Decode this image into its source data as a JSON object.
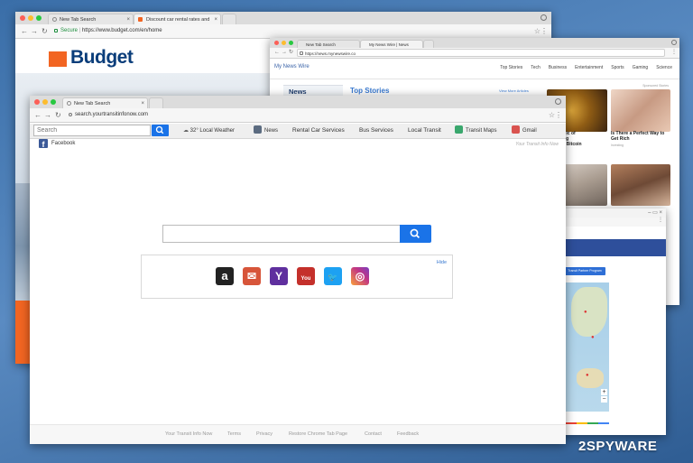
{
  "window_budget": {
    "tabs": [
      {
        "label": "New Tab Search"
      },
      {
        "label": "Discount car rental rates and"
      }
    ],
    "secure_label": "Secure",
    "url": "https://www.budget.com/en/home",
    "logo_text": "Budget"
  },
  "window_news": {
    "tabs": [
      {
        "label": "New Tab Search"
      },
      {
        "label": "My News Wire | News"
      }
    ],
    "url": "https://news.mynewswire.co",
    "site_name": "My News Wire",
    "nav": [
      "Top Stories",
      "Tech",
      "Business",
      "Entertainment",
      "Sports",
      "Gaming",
      "Science"
    ],
    "section_label": "News",
    "top_stories": "Top Stories",
    "view_more": "View More Articles",
    "sponsored": "Sponsored Stories",
    "story1": "n Republic of\nAre Going\nhse This Bitcoin",
    "story2": "Is There a Perfect Way to\nGet Rich",
    "story2_src": "Investing"
  },
  "window_map": {
    "program_button": "Transit Partner Program"
  },
  "window_main": {
    "tab": {
      "label": "New Tab Search"
    },
    "url": "search.yourtransitinfonow.com",
    "toolbar": {
      "search_placeholder": "Search",
      "weather": "32° Local Weather",
      "items": [
        "News",
        "Rental Car Services",
        "Bus Services",
        "Local Transit",
        "Transit Maps",
        "Gmail"
      ]
    },
    "facebook_label": "Facebook",
    "brand_caption": "Your Transit Info Now",
    "hide_label": "Hide",
    "quicklinks": [
      {
        "icon": "amazon-icon",
        "glyph": "a",
        "color": "#222222"
      },
      {
        "icon": "mail-icon",
        "glyph": "✉",
        "color": "#d7553a"
      },
      {
        "icon": "yahoo-icon",
        "glyph": "Y",
        "color": "#5f2f9e"
      },
      {
        "icon": "youtube-icon",
        "glyph": "You",
        "color": "#c4302b"
      },
      {
        "icon": "twitter-icon",
        "glyph": "🐦",
        "color": "#1da1f2"
      },
      {
        "icon": "instagram-icon",
        "glyph": "◎",
        "color": "#c13584"
      }
    ],
    "footer": [
      "Your Transit Info Now",
      "Terms",
      "Privacy",
      "Restore Chrome Tab Page",
      "Contact",
      "Feedback"
    ]
  },
  "watermark": "2SPYWARE",
  "colors": {
    "search_blue": "#1a73e8",
    "budget_orange": "#f26522",
    "budget_blue": "#0a3d7a"
  }
}
